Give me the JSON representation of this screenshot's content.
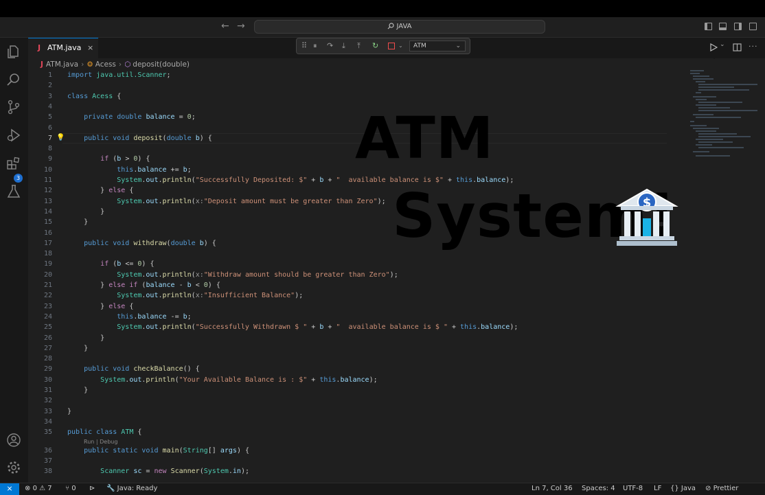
{
  "titlebar": {
    "search_text": "JAVA"
  },
  "tab": {
    "icon_letter": "J",
    "filename": "ATM.java",
    "close": "×"
  },
  "debug_toolbar": {
    "config": "ATM"
  },
  "breadcrumb": {
    "file": "ATM.java",
    "class_name": "Acess",
    "method": "deposit(double)"
  },
  "activity_bar": {
    "debug_badge": "3"
  },
  "editor": {
    "lines": [
      {
        "n": "1",
        "html": "<span class=\"kw\">import</span> <span class=\"ty\">java.util.Scanner</span>;"
      },
      {
        "n": "2",
        "html": ""
      },
      {
        "n": "3",
        "html": "<span class=\"kw\">class</span> <span class=\"ty\">Acess</span> {"
      },
      {
        "n": "4",
        "html": ""
      },
      {
        "n": "5",
        "html": "    <span class=\"kw\">private</span> <span class=\"kw\">double</span> <span class=\"var\">balance</span> = <span class=\"num\">0</span>;"
      },
      {
        "n": "6",
        "html": ""
      },
      {
        "n": "7",
        "html": "    <span class=\"kw\">public</span> <span class=\"kw\">void</span> <span class=\"fn\">deposit</span>(<span class=\"kw\">double</span> <span class=\"var\">b</span>) {"
      },
      {
        "n": "8",
        "html": ""
      },
      {
        "n": "9",
        "html": "        <span class=\"kw2\">if</span> (<span class=\"var\">b</span> > <span class=\"num\">0</span>) {"
      },
      {
        "n": "10",
        "html": "            <span class=\"kw\">this</span>.<span class=\"var\">balance</span> += <span class=\"var\">b</span>;"
      },
      {
        "n": "11",
        "html": "            <span class=\"ty\">System</span>.<span class=\"var\">out</span>.<span class=\"fn\">println</span>(<span class=\"str\">\"Successfully Deposited: $\"</span> + <span class=\"var\">b</span> + <span class=\"str\">\"  available balance is $\"</span> + <span class=\"kw\">this</span>.<span class=\"var\">balance</span>);"
      },
      {
        "n": "12",
        "html": "        } <span class=\"kw2\">else</span> {"
      },
      {
        "n": "13",
        "html": "            <span class=\"ty\">System</span>.<span class=\"var\">out</span>.<span class=\"fn\">println</span>(<span class=\"hint\">x:</span><span class=\"str\">\"Deposit amount must be greater than Zero\"</span>);"
      },
      {
        "n": "14",
        "html": "        }"
      },
      {
        "n": "15",
        "html": "    }"
      },
      {
        "n": "16",
        "html": ""
      },
      {
        "n": "17",
        "html": "    <span class=\"kw\">public</span> <span class=\"kw\">void</span> <span class=\"fn\">withdraw</span>(<span class=\"kw\">double</span> <span class=\"var\">b</span>) {"
      },
      {
        "n": "18",
        "html": ""
      },
      {
        "n": "19",
        "html": "        <span class=\"kw2\">if</span> (<span class=\"var\">b</span> <= <span class=\"num\">0</span>) {"
      },
      {
        "n": "20",
        "html": "            <span class=\"ty\">System</span>.<span class=\"var\">out</span>.<span class=\"fn\">println</span>(<span class=\"hint\">x:</span><span class=\"str\">\"Withdraw amount should be greater than Zero\"</span>);"
      },
      {
        "n": "21",
        "html": "        } <span class=\"kw2\">else</span> <span class=\"kw2\">if</span> (<span class=\"var\">balance</span> - <span class=\"var\">b</span> < <span class=\"num\">0</span>) {"
      },
      {
        "n": "22",
        "html": "            <span class=\"ty\">System</span>.<span class=\"var\">out</span>.<span class=\"fn\">println</span>(<span class=\"hint\">x:</span><span class=\"str\">\"Insufficient Balance\"</span>);"
      },
      {
        "n": "23",
        "html": "        } <span class=\"kw2\">else</span> {"
      },
      {
        "n": "24",
        "html": "            <span class=\"kw\">this</span>.<span class=\"var\">balance</span> -= <span class=\"var\">b</span>;"
      },
      {
        "n": "25",
        "html": "            <span class=\"ty\">System</span>.<span class=\"var\">out</span>.<span class=\"fn\">println</span>(<span class=\"str\">\"Successfully Withdrawn $ \"</span> + <span class=\"var\">b</span> + <span class=\"str\">\"  available balance is $ \"</span> + <span class=\"kw\">this</span>.<span class=\"var\">balance</span>);"
      },
      {
        "n": "26",
        "html": "        }"
      },
      {
        "n": "27",
        "html": "    }"
      },
      {
        "n": "28",
        "html": ""
      },
      {
        "n": "29",
        "html": "    <span class=\"kw\">public</span> <span class=\"kw\">void</span> <span class=\"fn\">checkBalance</span>() {"
      },
      {
        "n": "30",
        "html": "        <span class=\"ty\">System</span>.<span class=\"var\">out</span>.<span class=\"fn\">println</span>(<span class=\"str\">\"Your Available Balance is : $\"</span> + <span class=\"kw\">this</span>.<span class=\"var\">balance</span>);"
      },
      {
        "n": "31",
        "html": "    }"
      },
      {
        "n": "32",
        "html": ""
      },
      {
        "n": "33",
        "html": "}"
      },
      {
        "n": "34",
        "html": ""
      },
      {
        "n": "35",
        "html": "<span class=\"kw\">public</span> <span class=\"kw\">class</span> <span class=\"ty\">ATM</span> {"
      },
      {
        "n": "36",
        "html": "    <span class=\"kw\">public</span> <span class=\"kw\">static</span> <span class=\"kw\">void</span> <span class=\"fn\">main</span>(<span class=\"ty\">String</span>[] <span class=\"var\">args</span>) {"
      },
      {
        "n": "37",
        "html": ""
      },
      {
        "n": "38",
        "html": "        <span class=\"ty\">Scanner</span> <span class=\"var\">sc</span> = <span class=\"kw2\">new</span> <span class=\"fn\">Scanner</span>(<span class=\"ty\">System</span>.<span class=\"var\">in</span>);"
      }
    ],
    "current_line": "7",
    "code_lens": "Run | Debug"
  },
  "overlay": {
    "line1": "ATM",
    "line2": "System!"
  },
  "statusbar": {
    "errors": "0",
    "warnings": "7",
    "ports": "0",
    "java_status": "Java: Ready",
    "cursor": "Ln 7, Col 36",
    "spaces": "Spaces: 4",
    "encoding": "UTF-8",
    "eol": "LF",
    "language": "Java",
    "formatter": "Prettier"
  }
}
